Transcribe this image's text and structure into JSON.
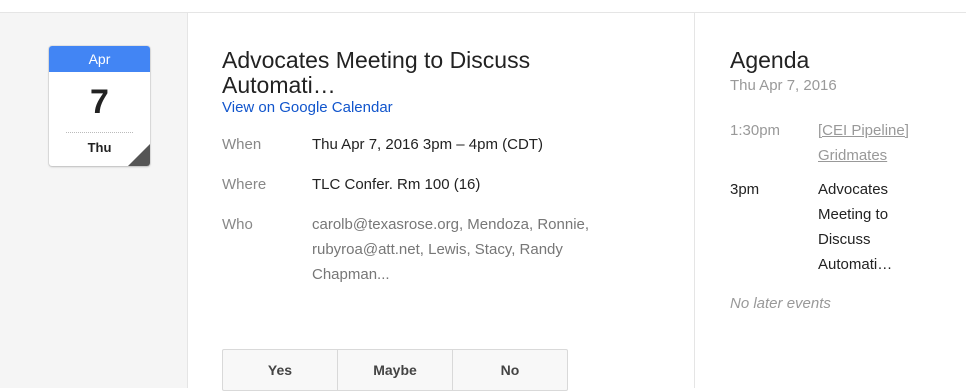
{
  "calendar_icon": {
    "month": "Apr",
    "day": "7",
    "weekday": "Thu",
    "accent_color": "#4285f4"
  },
  "event": {
    "title_line1": "Advocates Meeting to Discuss",
    "title_line2": "Automati…",
    "view_link": "View on Google Calendar",
    "when_label": "When",
    "when_value": "Thu Apr 7, 2016 3pm – 4pm (CDT)",
    "where_label": "Where",
    "where_value": "TLC Confer. Rm 100 (16)",
    "who_label": "Who",
    "who_value": "carolb@texasrose.org, Mendoza, Ronnie, rubyroa@att.net, Lewis, Stacy, Randy Chapman..."
  },
  "rsvp": {
    "yes": "Yes",
    "maybe": "Maybe",
    "no": "No"
  },
  "agenda": {
    "title": "Agenda",
    "date": "Thu Apr 7, 2016",
    "items": [
      {
        "time": "1:30pm",
        "title": "[CEI Pipeline] Gridmates"
      },
      {
        "time": "3pm",
        "title": "Advocates Meeting to Discuss Automati…"
      }
    ],
    "footer": "No later events"
  }
}
